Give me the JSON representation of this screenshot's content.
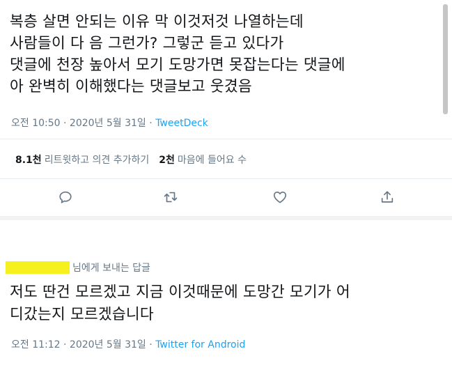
{
  "tweet": {
    "text": "복층 살면 안되는 이유 막 이것저것 나열하는데\n사람들이 다 음 그런가? 그렇군 듣고 있다가\n댓글에 천장 높아서 모기 도망가면 못잡는다는 댓글에\n아 완벽히 이해했다는 댓글보고 웃겼음",
    "time": "오전 10:50",
    "separator": " · ",
    "date": "2020년 5월 31일",
    "source": "TweetDeck",
    "retweet_count": "8.1천",
    "retweet_label": "리트윗하고 의견 추가하기",
    "like_count": "2천",
    "like_label": "마음에 들어요 수",
    "actions": {
      "reply_icon": "reply-icon",
      "retweet_icon": "retweet-icon",
      "like_icon": "heart-icon",
      "share_icon": "share-icon"
    }
  },
  "reply": {
    "reply_to_label": "님에게 보내는 답글",
    "text": "저도 딴건 모르겠고 지금 이것때문에 도망간 모기가 어\n디갔는지 모르겠습니다",
    "time": "오전 11:12",
    "separator": " · ",
    "date": "2020년 5월 31일",
    "source": "Twitter for Android"
  },
  "colors": {
    "text": "#14171a",
    "secondary": "#657786",
    "link": "#1da1f2",
    "redaction": "#f7f01f"
  }
}
